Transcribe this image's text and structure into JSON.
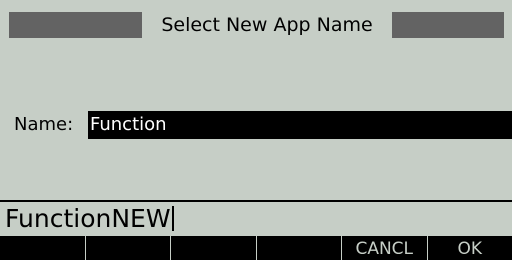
{
  "title": "Select New App Name",
  "name_row": {
    "label": "Name:",
    "value": "Function"
  },
  "entry": {
    "value": "FunctionNEW"
  },
  "menu": {
    "keys": [
      "",
      "",
      "",
      "",
      "CANCL",
      "OK"
    ]
  },
  "colors": {
    "background": "#c6cec6",
    "title_bar": "#636363",
    "highlight": "#000000",
    "highlight_text": "#ffffff",
    "menu_bar": "#000000"
  }
}
